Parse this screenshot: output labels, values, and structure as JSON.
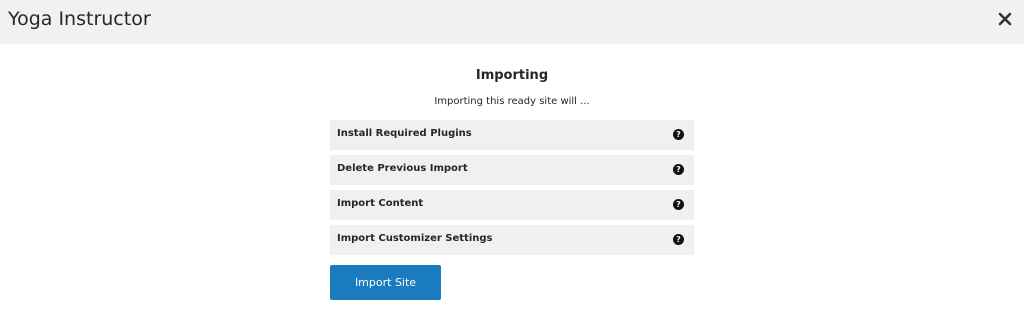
{
  "header": {
    "title": "Yoga Instructor",
    "close_icon": "close-icon"
  },
  "main": {
    "title": "Importing",
    "subtitle": "Importing this ready site will ...",
    "steps": [
      {
        "label": "Install Required Plugins",
        "icon": "help-icon",
        "icon_glyph": "?"
      },
      {
        "label": "Delete Previous Import",
        "icon": "help-icon",
        "icon_glyph": "?"
      },
      {
        "label": "Import Content",
        "icon": "help-icon",
        "icon_glyph": "?"
      },
      {
        "label": "Import Customizer Settings",
        "icon": "help-icon",
        "icon_glyph": "?"
      }
    ],
    "import_button": "Import Site"
  },
  "colors": {
    "header_bg": "#f1f1f1",
    "step_bg": "#f0f0f0",
    "button_bg": "#1a7bbf"
  }
}
